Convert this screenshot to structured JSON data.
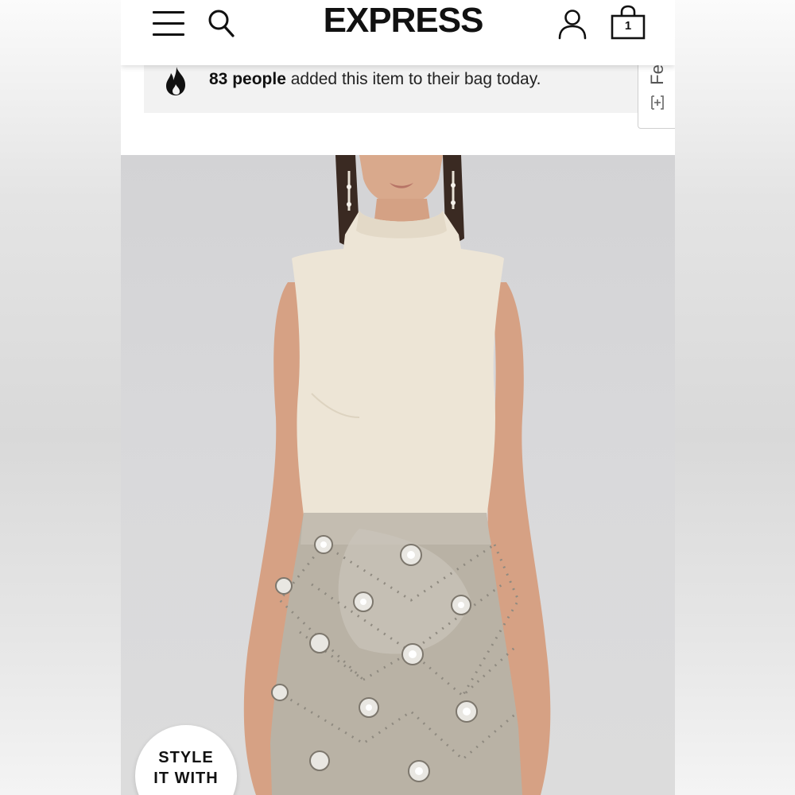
{
  "header": {
    "logo": "EXPRESS",
    "bag_count": "1",
    "icons": [
      "menu-icon",
      "search-icon",
      "account-icon",
      "shopping-bag-icon"
    ]
  },
  "banner": {
    "icon": "fire-icon",
    "count_text": "83 people",
    "rest_text": " added this item to their bag today."
  },
  "feedback": {
    "label": "Fe",
    "icon": "plus-box-icon"
  },
  "product": {
    "image_alt": "Model wearing sleeveless ivory mock neck top and embellished metallic mini skirt"
  },
  "style_badge": {
    "line1": "STYLE",
    "line2": "IT WITH"
  },
  "colors": {
    "background": "#ffffff",
    "banner_bg": "#f2f2f2",
    "text": "#111111"
  }
}
